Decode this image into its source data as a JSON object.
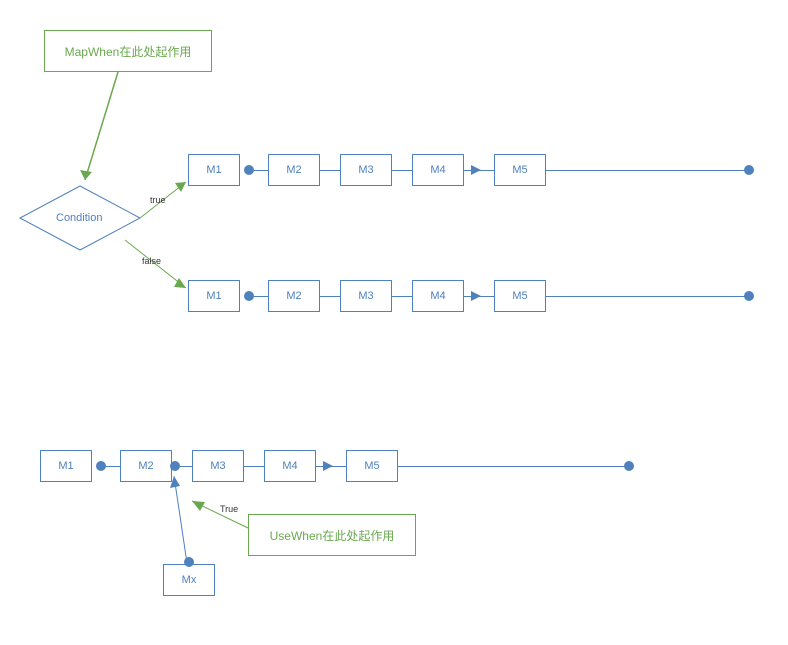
{
  "callouts": {
    "mapwhen": "MapWhen在此处起作用",
    "usewhen": "UseWhen在此处起作用"
  },
  "condition": "Condition",
  "edge_labels": {
    "true": "true",
    "false": "false",
    "true2": "True"
  },
  "pipelines": {
    "top": {
      "m1": "M1",
      "m2": "M2",
      "m3": "M3",
      "m4": "M4",
      "m5": "M5"
    },
    "mid": {
      "m1": "M1",
      "m2": "M2",
      "m3": "M3",
      "m4": "M4",
      "m5": "M5"
    },
    "bottom": {
      "m1": "M1",
      "m2": "M2",
      "m3": "M3",
      "m4": "M4",
      "m5": "M5"
    }
  },
  "branch_box": "Mx",
  "colors": {
    "blue": "#4f81bd",
    "green": "#6aa84f"
  }
}
